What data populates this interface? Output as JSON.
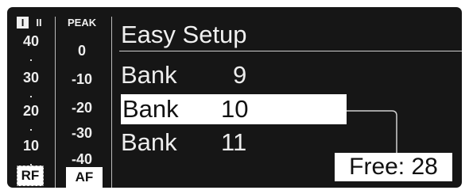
{
  "header": {
    "receiver_labels": [
      "I",
      "II"
    ],
    "peak_label": "PEAK",
    "title": "Easy Setup"
  },
  "rf_meter": {
    "scale": [
      "40",
      "30",
      "20",
      "10"
    ],
    "label": "RF"
  },
  "af_meter": {
    "scale": [
      "0",
      "-10",
      "-20",
      "-30",
      "-40"
    ],
    "label": "AF"
  },
  "menu": {
    "items": [
      {
        "label": "Bank",
        "value": "9",
        "selected": false
      },
      {
        "label": "Bank",
        "value": "10",
        "selected": true
      },
      {
        "label": "Bank",
        "value": "11",
        "selected": false
      }
    ]
  },
  "status": {
    "free_text": "Free: 28"
  },
  "colors": {
    "background": "#161616",
    "foreground": "#f0f0f0",
    "highlight": "#ffffff"
  }
}
